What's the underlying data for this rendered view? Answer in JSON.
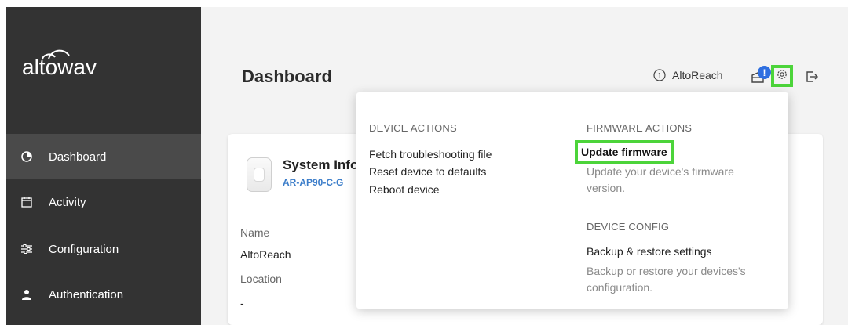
{
  "app": {
    "logo_text": "altowav"
  },
  "sidebar": {
    "items": [
      {
        "label": "Dashboard",
        "icon": "pie-chart-icon",
        "active": true
      },
      {
        "label": "Activity",
        "icon": "calendar-icon",
        "active": false
      },
      {
        "label": "Configuration",
        "icon": "sliders-icon",
        "active": false
      },
      {
        "label": "Authentication",
        "icon": "user-icon",
        "active": false
      }
    ]
  },
  "header": {
    "title": "Dashboard",
    "device_name": "AltoReach",
    "notification_badge": "!",
    "icons": [
      "info-icon",
      "bell-icon",
      "gear-icon",
      "logout-icon"
    ]
  },
  "card": {
    "title": "System Info",
    "model": "AR-AP90-C-G",
    "fields": [
      {
        "label": "Name",
        "value": "AltoReach"
      },
      {
        "label": "Location",
        "value": "-"
      }
    ]
  },
  "dropdown": {
    "device_actions": {
      "heading": "DEVICE ACTIONS",
      "items": [
        "Fetch troubleshooting file",
        "Reset device to defaults",
        "Reboot device"
      ]
    },
    "firmware_actions": {
      "heading": "FIRMWARE ACTIONS",
      "item_label": "Update firmware",
      "item_desc": "Update your device's firmware version."
    },
    "device_config": {
      "heading": "DEVICE CONFIG",
      "item_label": "Backup & restore settings",
      "item_desc": "Backup or restore your devices's configuration."
    }
  },
  "colors": {
    "sidebar_bg": "#333333",
    "active_bg": "#4a4a4a",
    "highlight": "#4cd43a",
    "link_blue": "#3a7cc9",
    "badge_blue": "#2f6fe0"
  }
}
